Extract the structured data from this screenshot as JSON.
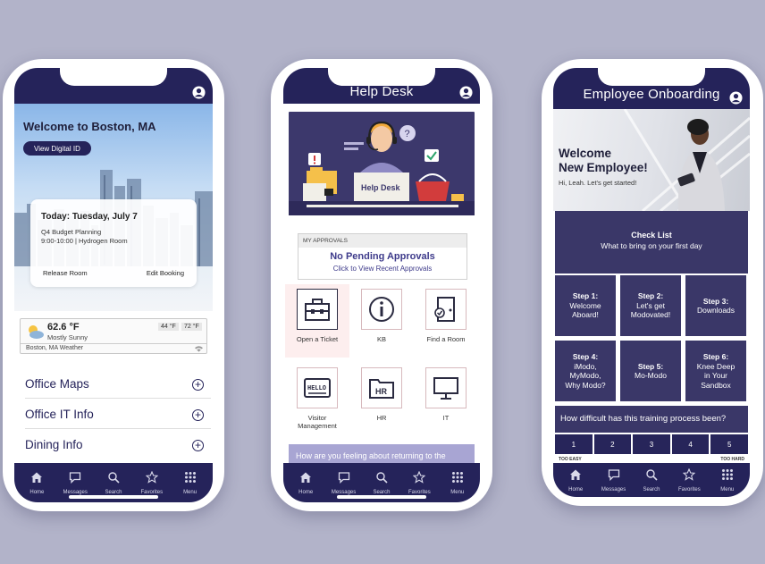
{
  "colors": {
    "brand": "#25235a",
    "tile": "#3a3768",
    "background": "#b2b3c9",
    "accent_link": "#3d3a8a"
  },
  "tabbar": [
    {
      "label": "Home",
      "icon": "home-icon"
    },
    {
      "label": "Messages",
      "icon": "message-icon"
    },
    {
      "label": "Search",
      "icon": "search-icon"
    },
    {
      "label": "Favorites",
      "icon": "star-icon"
    },
    {
      "label": "Menu",
      "icon": "grid-icon"
    }
  ],
  "phone1": {
    "welcome": "Welcome to Boston, MA",
    "digital_id_button": "View Digital ID",
    "booking": {
      "date": "Today: Tuesday, July 7",
      "meeting_title": "Q4 Budget Planning",
      "meeting_time_room": "9:00-10:00 | Hydrogen Room",
      "release_label": "Release Room",
      "edit_label": "Edit Booking"
    },
    "weather": {
      "temp": "62.6 °F",
      "condition": "Mostly Sunny",
      "high": "44 °F",
      "low": "72 °F",
      "location": "Boston, MA Weather"
    },
    "list": [
      "Office Maps",
      "Office IT Info",
      "Dining Info"
    ]
  },
  "phone2": {
    "title": "Help Desk",
    "banner_sign": "Help Desk",
    "approvals": {
      "header": "MY APPROVALS",
      "status": "No Pending Approvals",
      "link": "Click to View Recent Approvals"
    },
    "icons": [
      {
        "label": "Open a Ticket"
      },
      {
        "label": "KB"
      },
      {
        "label": "Find a Room"
      },
      {
        "label_line1": "Visitor",
        "label_line2": "Management"
      },
      {
        "label": "HR"
      },
      {
        "label": "IT"
      }
    ],
    "feeling_prompt": "How are you feeling about returning to the",
    "visitor_sticker": "HELLO",
    "hr_folder": "HR"
  },
  "phone3": {
    "title": "Employee Onboarding",
    "welcome_line1": "Welcome",
    "welcome_line2": "New Employee!",
    "greeting": "Hi, Leah. Let's get started!",
    "checklist_title": "Check List",
    "checklist_subtitle": "What to bring on your first day",
    "steps": [
      {
        "name": "Step 1:",
        "l1": "Welcome",
        "l2": "Aboard!",
        "l3": ""
      },
      {
        "name": "Step 2:",
        "l1": "Let's get",
        "l2": "Modovated!",
        "l3": ""
      },
      {
        "name": "Step 3:",
        "l1": "Downloads",
        "l2": "",
        "l3": ""
      },
      {
        "name": "Step 4:",
        "l1": "iModo,",
        "l2": "MyModo,",
        "l3": "Why Modo?"
      },
      {
        "name": "Step 5:",
        "l1": "Mo-Modo",
        "l2": "",
        "l3": ""
      },
      {
        "name": "Step 6:",
        "l1": "Knee Deep",
        "l2": "in Your",
        "l3": "Sandbox"
      }
    ],
    "question": "How difficult has this training process been?",
    "scale": [
      "1",
      "2",
      "3",
      "4",
      "5"
    ],
    "scale_low": "TOO EASY",
    "scale_high": "TOO HARD"
  }
}
